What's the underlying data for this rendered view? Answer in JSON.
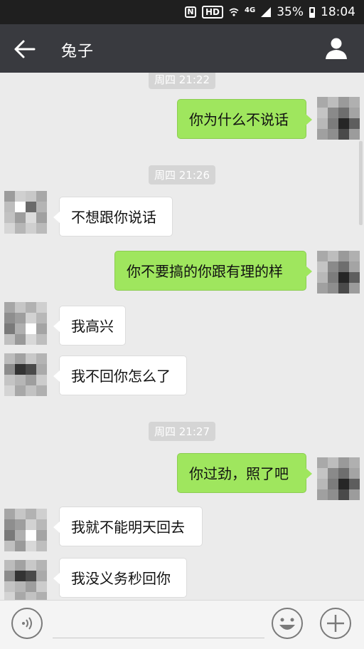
{
  "status_bar": {
    "network": "4G",
    "battery": "35%",
    "time": "18:04",
    "hd": "HD",
    "nfc": "N"
  },
  "header": {
    "title": "兔子"
  },
  "timestamps": [
    "周四 21:22",
    "周四 21:26",
    "周四 21:27"
  ],
  "messages": [
    {
      "side": "right",
      "text": "你为什么不说话"
    },
    {
      "side": "left",
      "text": "不想跟你说话"
    },
    {
      "side": "right",
      "text": "你不要搞的你跟有理的样"
    },
    {
      "side": "left",
      "text": "我高兴"
    },
    {
      "side": "left",
      "text": "我不回你怎么了"
    },
    {
      "side": "right",
      "text": "你过劲，照了吧"
    },
    {
      "side": "left",
      "text": "我就不能明天回去"
    },
    {
      "side": "left",
      "text": "我没义务秒回你"
    }
  ],
  "colors": {
    "sent_bubble": "#9fe65e",
    "received_bubble": "#ffffff",
    "header_bg": "#393a3f",
    "status_bg": "#1f1f1f"
  },
  "icons": {
    "back": "arrow-left-icon",
    "profile": "person-icon",
    "voice": "voice-icon",
    "emoji": "smiley-icon",
    "more": "plus-icon"
  }
}
